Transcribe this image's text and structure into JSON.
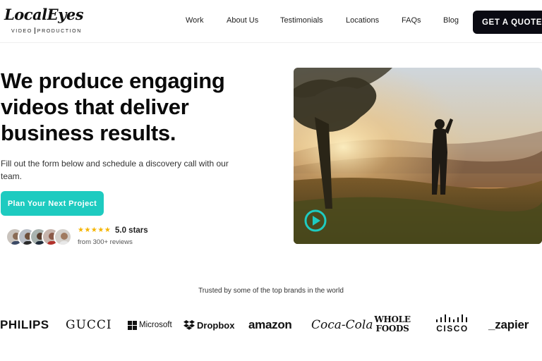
{
  "logo": {
    "name": "LocalEyes",
    "sub_left": "VIDEO",
    "sub_right": "PRODUCTION"
  },
  "nav": {
    "items": [
      "Work",
      "About Us",
      "Testimonials",
      "Locations",
      "FAQs",
      "Blog"
    ],
    "cta_label": "GET A QUOTE"
  },
  "hero": {
    "headline_lines": [
      "We produce engaging",
      "videos that deliver",
      "business results."
    ],
    "subtext": "Fill out the form below and schedule a discovery call with our team.",
    "cta_label": "Plan Your Next Project",
    "stars": "★★★★★",
    "rating_value": 5.0,
    "rating_label": "5.0 stars",
    "reviews_label": "from 300+ reviews",
    "video_icon": "play-icon"
  },
  "brands": {
    "heading": "Trusted by some of the top brands in the world",
    "items": [
      "PHILIPS",
      "GUCCI",
      "Microsoft",
      "Dropbox",
      "amazon",
      "Coca-Cola",
      "WHOLE FOODS",
      "CISCO",
      "_zapier"
    ]
  },
  "colors": {
    "accent": "#1ecbc0",
    "dark_button": "#0a0a12",
    "star": "#f5b400"
  }
}
